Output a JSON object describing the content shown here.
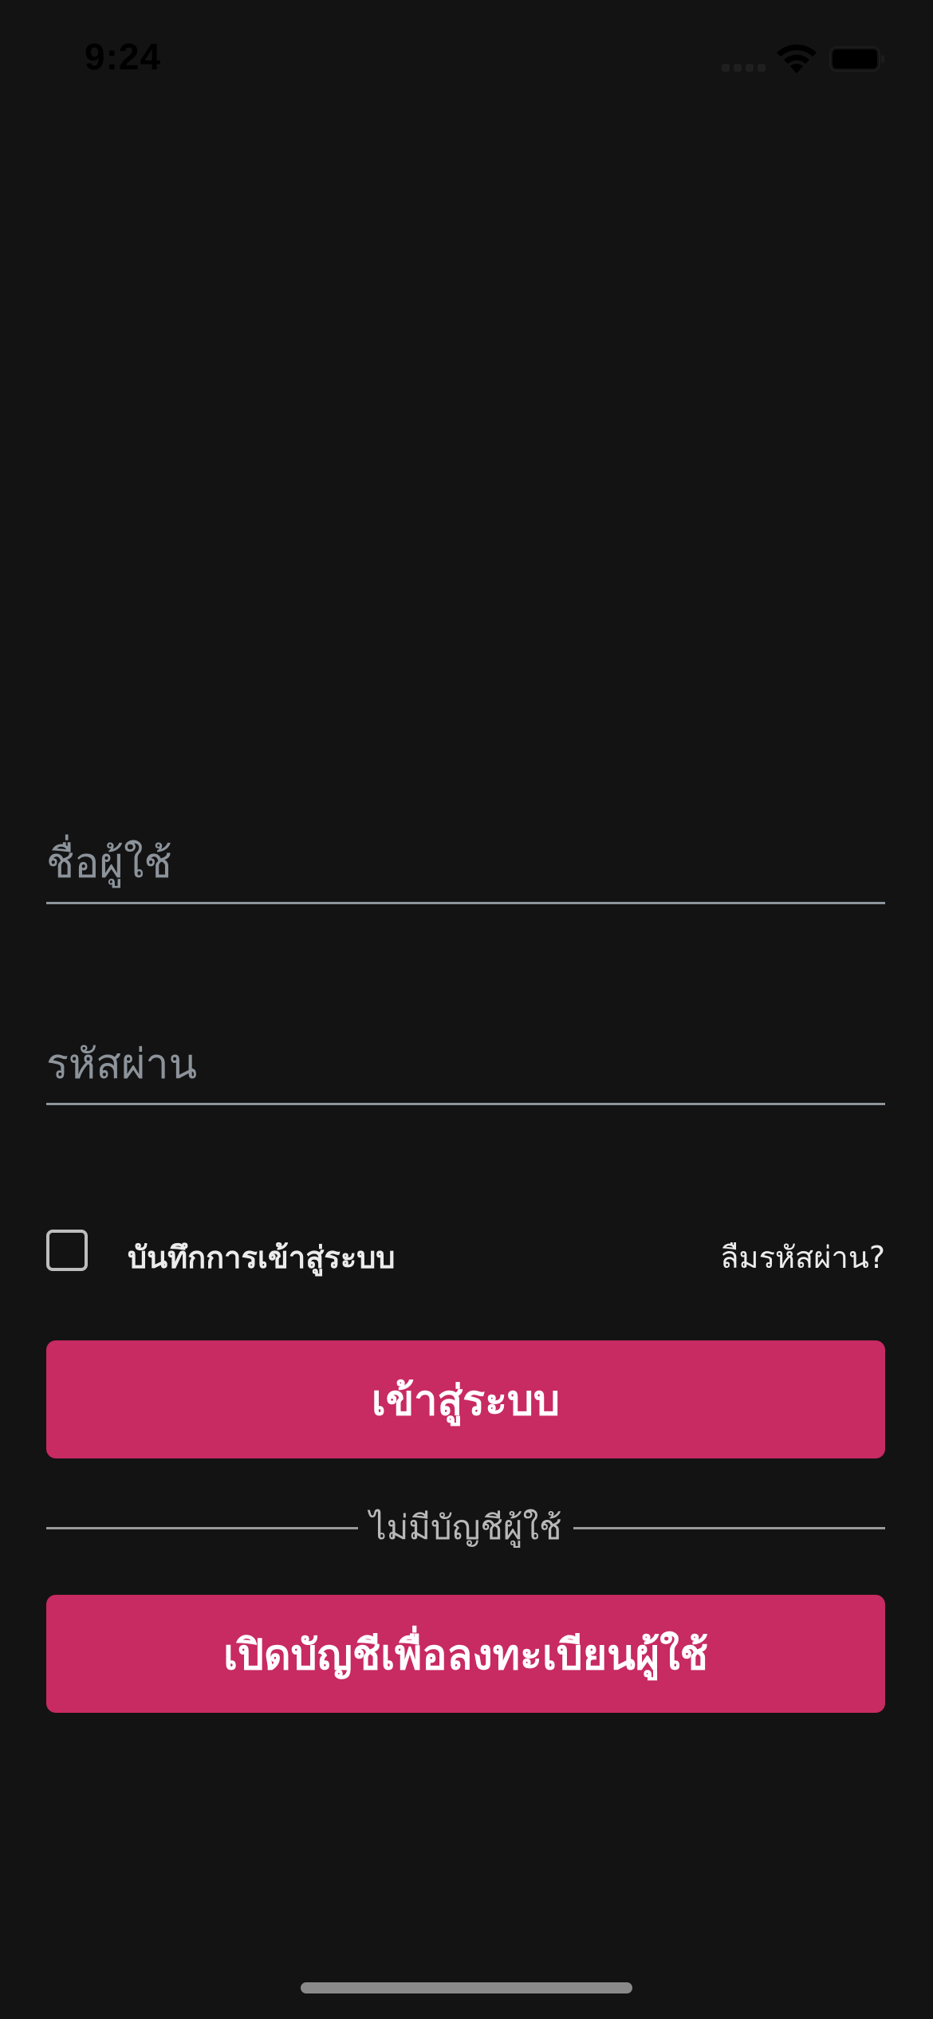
{
  "status_bar": {
    "time": "9:24"
  },
  "login_form": {
    "username_placeholder": "ชื่อผู้ใช้",
    "password_placeholder": "รหัสผ่าน",
    "remember_label": "บันทึกการเข้าสู่ระบบ",
    "forgot_link": "ลืมรหัสผ่าน?",
    "login_button": "เข้าสู่ระบบ",
    "divider_text": "ไม่มีบัญชีผู้ใช้",
    "register_button": "เปิดบัญชีเพื่อลงทะเบียนผู้ใช้"
  },
  "colors": {
    "background": "#131313",
    "accent": "#c82a62"
  },
  "icons": [
    "signal-icon",
    "wifi-icon",
    "battery-icon"
  ]
}
